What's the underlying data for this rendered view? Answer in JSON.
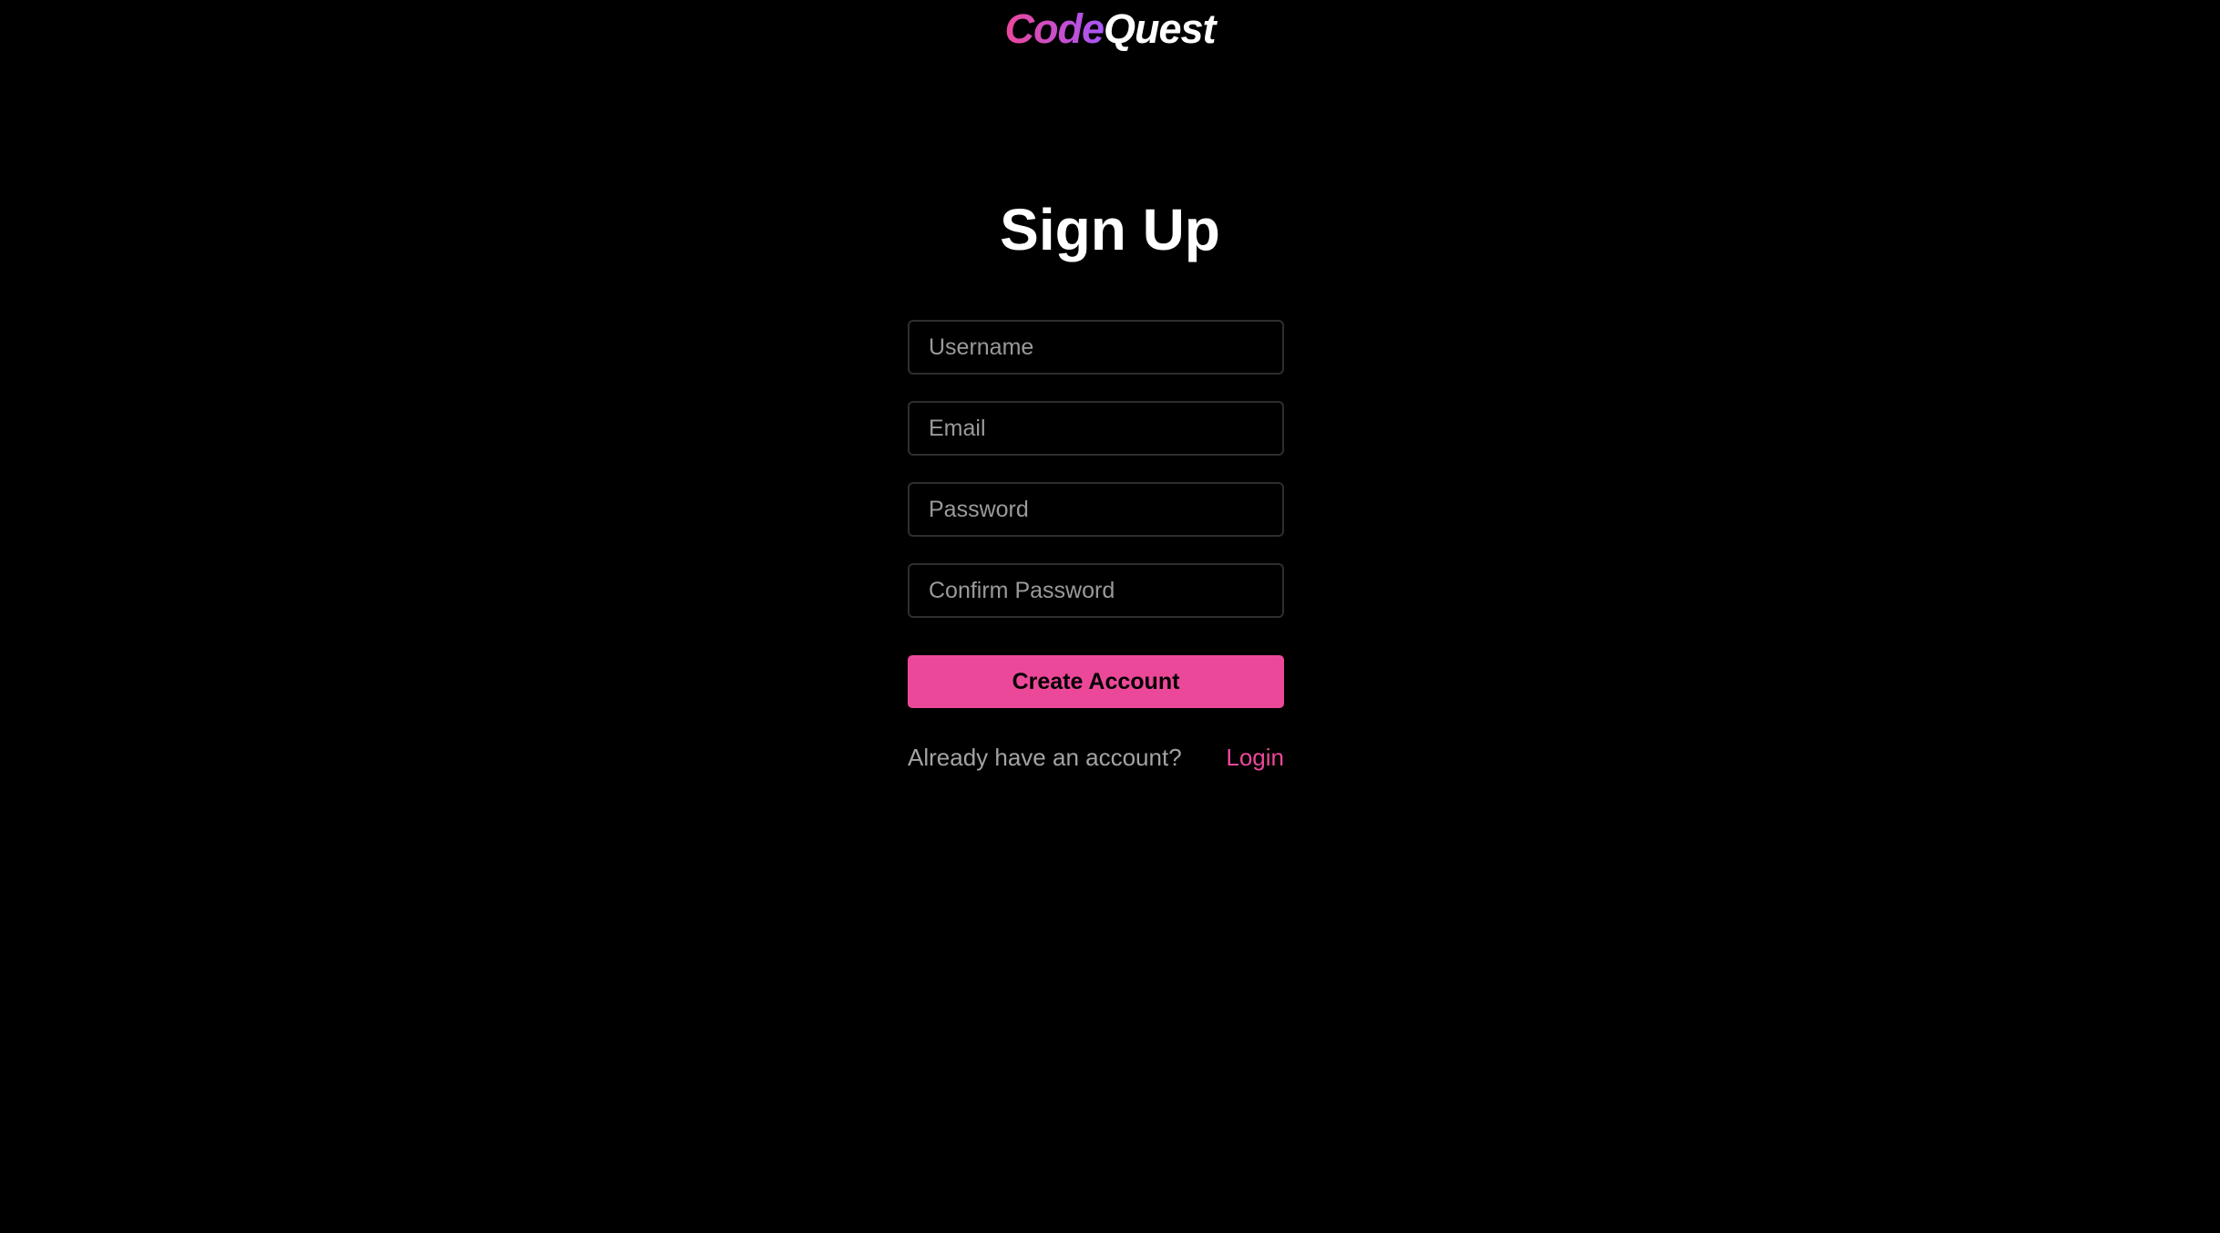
{
  "brand": {
    "part1": "Code",
    "part2": "Quest"
  },
  "page_title": "Sign Up",
  "form": {
    "username_placeholder": "Username",
    "email_placeholder": "Email",
    "password_placeholder": "Password",
    "confirm_password_placeholder": "Confirm Password",
    "submit_label": "Create Account"
  },
  "footer": {
    "prompt": "Already have an account?",
    "login_label": "Login"
  },
  "colors": {
    "background": "#000000",
    "accent": "#ec4899",
    "brand_gradient_end": "#a855f7",
    "text_primary": "#ffffff",
    "text_muted": "#a3a3a3"
  }
}
